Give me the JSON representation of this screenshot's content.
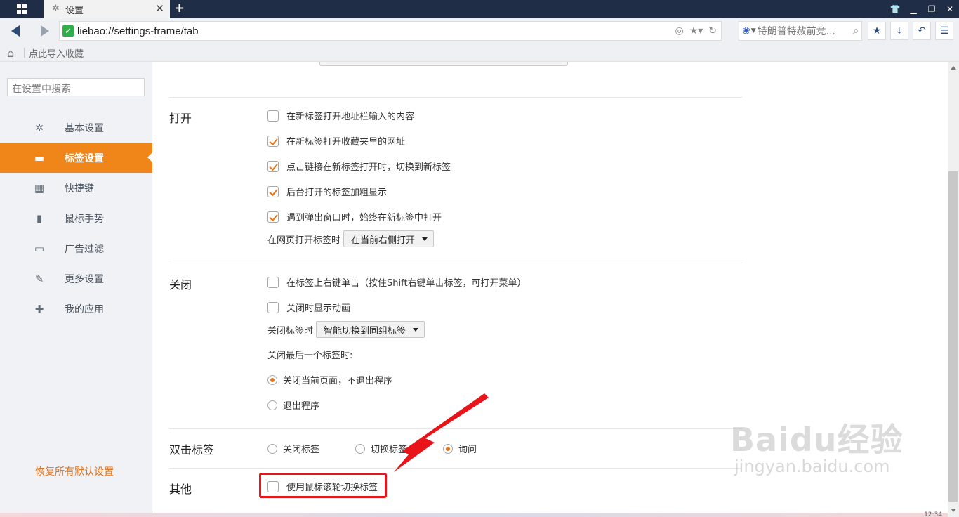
{
  "titlebar": {
    "tab_title": "设置",
    "tab_icon": "gear-icon",
    "close_glyph": "✕",
    "newtab_glyph": "+"
  },
  "navbar": {
    "url": "liebao://settings-frame/tab",
    "search_text": "特朗普特赦前竞...",
    "search_engine_icon": "baidu-paw-icon"
  },
  "bookmarks": {
    "import_link": "点此导入收藏"
  },
  "sidebar": {
    "search_placeholder": "在设置中搜索",
    "items": [
      {
        "label": "基本设置",
        "icon": "gear-icon",
        "active": false
      },
      {
        "label": "标签设置",
        "icon": "tab-icon",
        "active": true
      },
      {
        "label": "快捷键",
        "icon": "keyboard-icon",
        "active": false
      },
      {
        "label": "鼠标手势",
        "icon": "mouse-icon",
        "active": false
      },
      {
        "label": "广告过滤",
        "icon": "window-icon",
        "active": false
      },
      {
        "label": "更多设置",
        "icon": "wrench-icon",
        "active": false
      },
      {
        "label": "我的应用",
        "icon": "puzzle-icon",
        "active": false
      }
    ],
    "restore_link": "恢复所有默认设置"
  },
  "sections": {
    "open": {
      "title": "打开",
      "options": [
        {
          "label": "在新标签打开地址栏输入的内容",
          "checked": false
        },
        {
          "label": "在新标签打开收藏夹里的网址",
          "checked": true
        },
        {
          "label": "点击链接在新标签打开时，切换到新标签",
          "checked": true
        },
        {
          "label": "后台打开的标签加粗显示",
          "checked": true
        },
        {
          "label": "遇到弹出窗口时，始终在新标签中打开",
          "checked": true
        }
      ],
      "select_label": "在网页打开标签时",
      "select_value": "在当前右侧打开"
    },
    "close": {
      "title": "关闭",
      "options": [
        {
          "label": "在标签上右键单击（按住Shift右键单击标签，可打开菜单）",
          "checked": false
        },
        {
          "label": "关闭时显示动画",
          "checked": false
        }
      ],
      "select_label": "关闭标签时",
      "select_value": "智能切换到同组标签",
      "last_tab_label": "关闭最后一个标签时:",
      "last_tab_options": [
        {
          "label": "关闭当前页面，不退出程序",
          "selected": true
        },
        {
          "label": "退出程序",
          "selected": false
        }
      ]
    },
    "dblclick": {
      "title": "双击标签",
      "options": [
        {
          "label": "关闭标签",
          "selected": false
        },
        {
          "label": "切换标签",
          "selected": false
        },
        {
          "label": "询问",
          "selected": true
        }
      ]
    },
    "other": {
      "title": "其他",
      "options": [
        {
          "label": "使用鼠标滚轮切换标签",
          "checked": false
        }
      ]
    }
  },
  "watermark": {
    "main": "Baidu经验",
    "sub": "jingyan.baidu.com"
  },
  "clock": "12:34",
  "colors": {
    "accent": "#f0851a",
    "titlebar": "#1f2d46",
    "annotation_red": "#e8141a"
  }
}
